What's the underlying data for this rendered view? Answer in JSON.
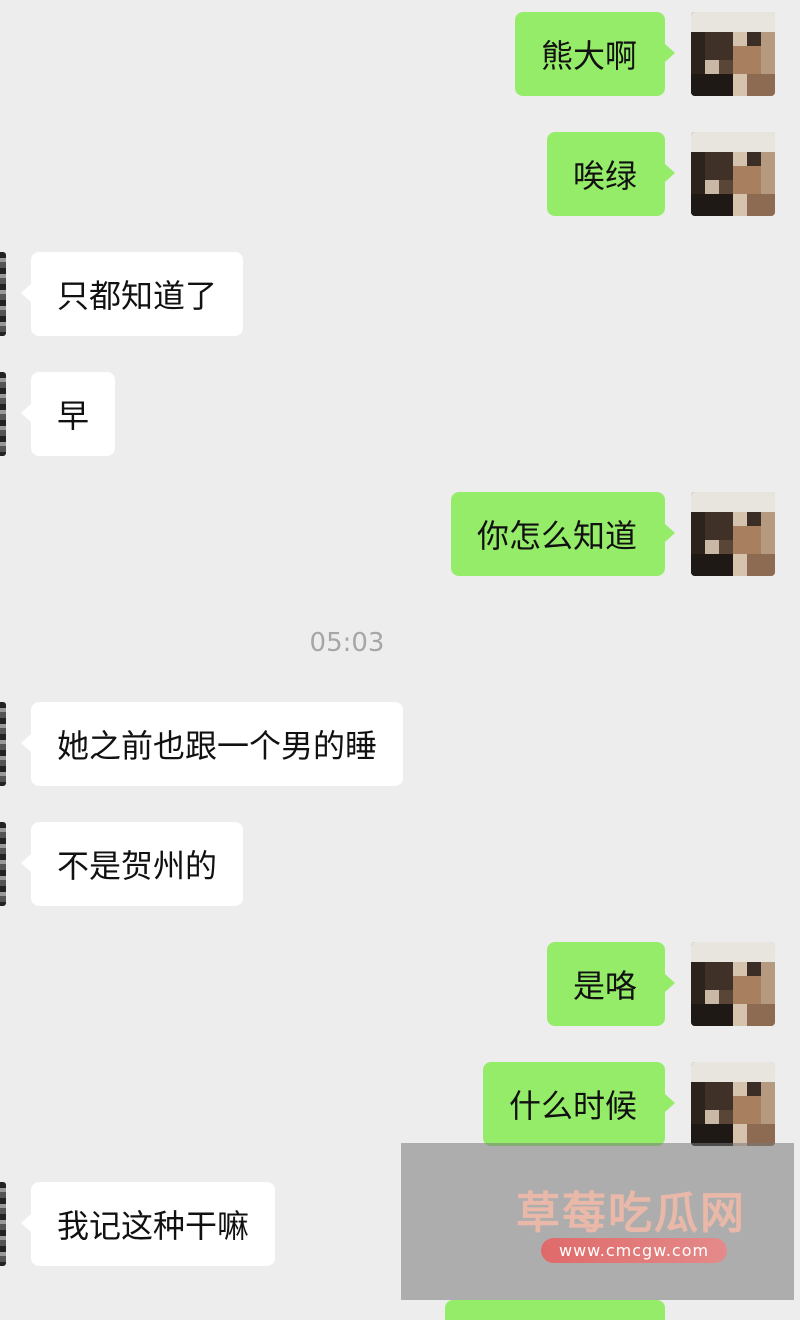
{
  "messages": [
    {
      "side": "out",
      "text": "熊大啊"
    },
    {
      "side": "out",
      "text": "唉绿"
    },
    {
      "side": "in",
      "text": "只都知道了"
    },
    {
      "side": "in",
      "text": "早"
    },
    {
      "side": "out",
      "text": "你怎么知道"
    },
    {
      "side": "in",
      "text": "她之前也跟一个男的睡"
    },
    {
      "side": "in",
      "text": "不是贺州的"
    },
    {
      "side": "out",
      "text": "是咯"
    },
    {
      "side": "out",
      "text": "什么时候"
    },
    {
      "side": "in",
      "text": "我记这种干嘛"
    }
  ],
  "timestamp": "05:03",
  "watermark": {
    "title": "草莓吃瓜网",
    "url": "www.cmcgw.com"
  },
  "colors": {
    "background": "#ededed",
    "outgoing_bubble": "#95ec69",
    "incoming_bubble": "#ffffff"
  },
  "icons": {
    "outgoing_avatar": "pixelated-avatar-icon",
    "incoming_avatar": "pixelated-avatar-icon"
  }
}
